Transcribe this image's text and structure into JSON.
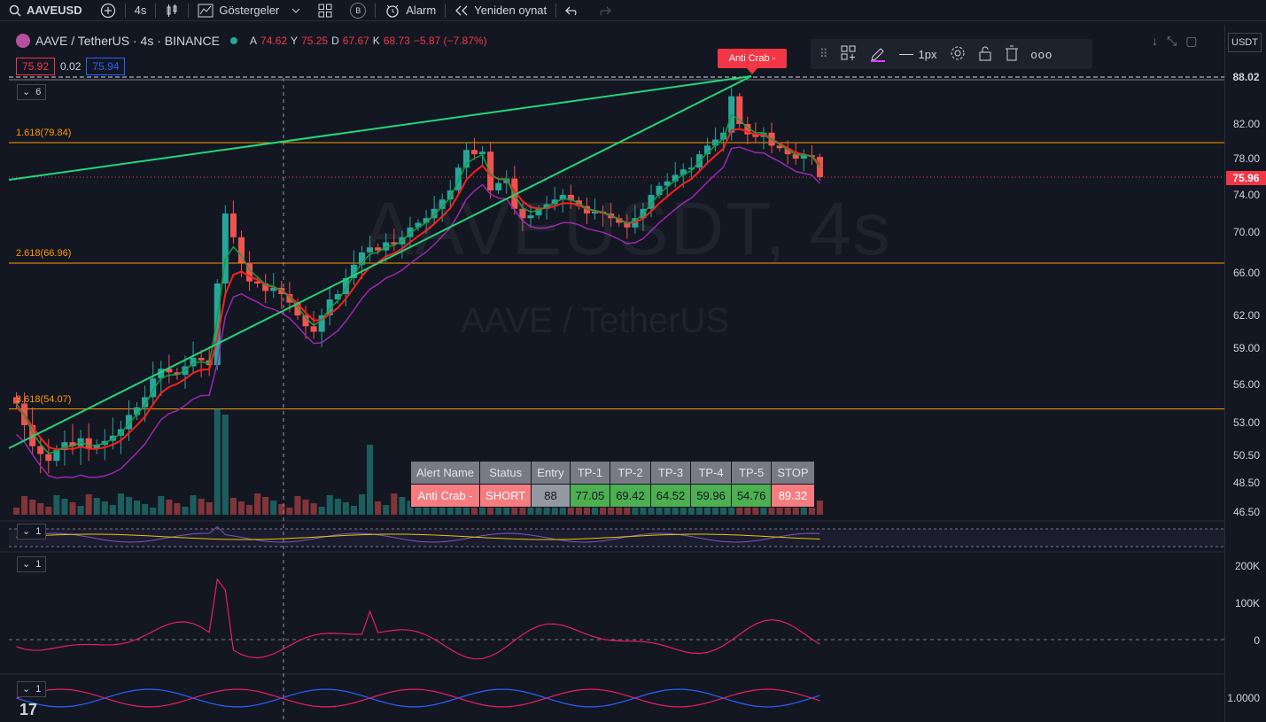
{
  "toolbar": {
    "symbol": "AAVEUSD",
    "interval": "4s",
    "indicators_label": "Göstergeler",
    "alarm_label": "Alarm",
    "replay_label": "Yeniden oynat",
    "b_label": "B"
  },
  "legend": {
    "symbol_full": "AAVE / TetherUS · 4s · BINANCE",
    "o_label": "A",
    "o_val": "74.62",
    "h_label": "Y",
    "h_val": "75.25",
    "l_label": "D",
    "l_val": "67.67",
    "c_label": "K",
    "c_val": "68.73",
    "change": "−5.87 (−7.87%)",
    "bid": "75.92",
    "spread": "0.02",
    "ask": "75.94",
    "collapsed_count": "6"
  },
  "watermark": {
    "big": "AAVEUSDT, 4s",
    "small": "AAVE / TetherUS"
  },
  "drawing_toolbar": {
    "width_label": "1px"
  },
  "anti_badge": "Anti Crab -",
  "fib_labels": {
    "f1618": "1.618(79.84)",
    "f2618": "2.618(66.96)",
    "f3618": "3.618(54.07)"
  },
  "price_axis": {
    "currency": "USDT",
    "ticks": [
      "82.00",
      "78.00",
      "74.00",
      "70.00",
      "66.00",
      "62.00",
      "59.00",
      "56.00",
      "53.00",
      "50.50",
      "48.50",
      "46.50"
    ],
    "tag_high": "88.02",
    "tag_last": "75.96",
    "vol_ticks": [
      "200K",
      "100K",
      "0"
    ],
    "osc_tick": "1.0000"
  },
  "panes": {
    "p1": "1",
    "p2": "1",
    "p3": "1"
  },
  "alert_table": {
    "headers": [
      "Alert Name",
      "Status",
      "Entry",
      "TP-1",
      "TP-2",
      "TP-3",
      "TP-4",
      "TP-5",
      "STOP"
    ],
    "row": [
      "Anti Crab -",
      "SHORT",
      "88",
      "77.05",
      "69.42",
      "64.52",
      "59.96",
      "54.76",
      "89.32"
    ]
  },
  "colors": {
    "bg": "#131722",
    "up": "#26a69a",
    "down": "#ef5350",
    "trend": "#22d67a",
    "fib": "#ff9800",
    "ema_red": "#ff1e1e",
    "ema_green": "#1b9e3e",
    "supertrend": "#9c27b0"
  },
  "chart_data": {
    "type": "candlestick",
    "series_close": [
      54.5,
      52.8,
      51.2,
      50.6,
      50.1,
      50.9,
      51.5,
      51.2,
      51.8,
      51.0,
      51.3,
      51.6,
      52.0,
      52.5,
      53.6,
      54.2,
      55.0,
      56.5,
      57.3,
      57.0,
      56.8,
      57.5,
      58.2,
      58.0,
      57.6,
      65.0,
      72.0,
      69.5,
      67.0,
      65.2,
      65.0,
      64.3,
      64.6,
      64.0,
      63.2,
      62.0,
      61.0,
      60.5,
      62.0,
      63.5,
      64.0,
      65.5,
      66.8,
      68.0,
      68.5,
      68.2,
      69.0,
      68.8,
      69.5,
      70.5,
      71.0,
      71.5,
      72.5,
      73.5,
      74.5,
      77.0,
      79.0,
      78.5,
      78.8,
      74.5,
      75.3,
      75.8,
      72.5,
      71.5,
      71.8,
      72.5,
      73.0,
      73.5,
      74.0,
      73.4,
      72.8,
      72.0,
      72.2,
      72.0,
      71.5,
      71.0,
      70.5,
      71.5,
      72.5,
      74.0,
      75.0,
      75.5,
      76.2,
      76.8,
      77.0,
      78.5,
      79.5,
      80.2,
      81.0,
      85.5,
      82.0,
      80.8,
      80.5,
      81.0,
      79.5,
      79.2,
      78.5,
      78.0,
      78.4,
      78.2,
      75.96
    ],
    "volume_y_ticks": [
      "200K",
      "100K",
      "0"
    ]
  }
}
